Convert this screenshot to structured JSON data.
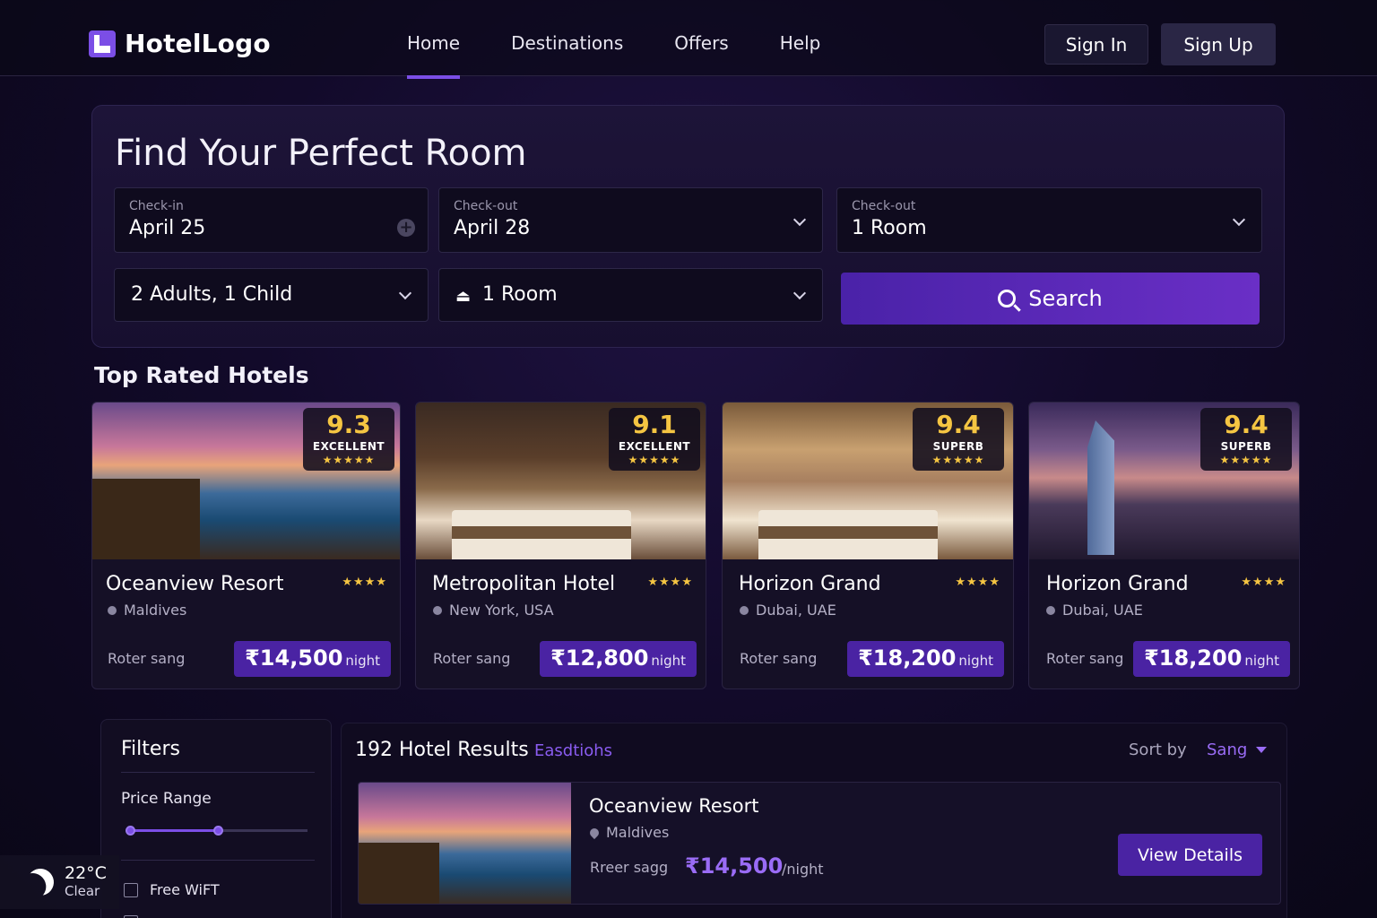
{
  "nav": {
    "logo": "HotelLogo",
    "links": [
      "Home",
      "Destinations",
      "Offers",
      "Help"
    ],
    "active": "Home",
    "sign_in": "Sign In",
    "sign_up": "Sign Up"
  },
  "search": {
    "title": "Find Your Perfect Room",
    "checkin": {
      "label": "Check-in",
      "value": "April 25"
    },
    "checkout": {
      "label": "Check-out",
      "value": "April 28"
    },
    "rooms_top": {
      "label": "Check-out",
      "value": "1 Room"
    },
    "guests": "2 Adults, 1 Child",
    "rooms": "1 Room",
    "button": "Search"
  },
  "top_rated": {
    "title": "Top Rated Hotels",
    "cards": [
      {
        "name": "Oceanview Resort",
        "location": "Maldives",
        "score": "9.3",
        "rating_word": "EXCELLENT",
        "stars": "★★★★★",
        "hotel_stars": "★★★★",
        "sub": "Roter sang",
        "price": "₹14,500",
        "per": "night"
      },
      {
        "name": "Metropolitan Hotel",
        "location": "New York, USA",
        "score": "9.1",
        "rating_word": "EXCELLENT",
        "stars": "★★★★★",
        "hotel_stars": "★★★★",
        "sub": "Roter sang",
        "price": "₹12,800",
        "per": "night"
      },
      {
        "name": "Horizon Grand",
        "location": "Dubai, UAE",
        "score": "9.4",
        "rating_word": "SUPERB",
        "stars": "★★★★★",
        "hotel_stars": "★★★★",
        "sub": "Roter sang",
        "price": "₹18,200",
        "per": "night"
      },
      {
        "name": "Horizon Grand",
        "location": "Dubai, UAE",
        "score": "9.4",
        "rating_word": "SUPERB",
        "stars": "★★★★★",
        "hotel_stars": "★★★★",
        "sub": "Roter sang",
        "price": "₹18,200",
        "per": "night"
      }
    ]
  },
  "filters": {
    "title": "Filters",
    "price_range_label": "Price Range",
    "price_range_fraction": 0.5,
    "free_wifi": "Free WiFT"
  },
  "weather": {
    "temp": "22°C",
    "condition": "Clear"
  },
  "results": {
    "count_title": "192 Hotel Results",
    "link": "Easdtiohs",
    "sort_label": "Sort by",
    "sort_value": "Sang",
    "row": {
      "name": "Oceanview Resort",
      "location": "Maldives",
      "sub": "Rreer sagg",
      "price": "₹14,500",
      "per": "/night",
      "button": "View Details"
    }
  },
  "colors": {
    "accent": "#7b4ee6",
    "price_pill": "#4a23a3",
    "star": "#f5c542"
  }
}
